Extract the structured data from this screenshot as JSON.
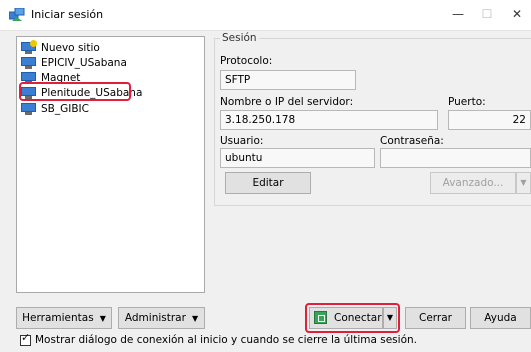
{
  "window": {
    "title": "Iniciar sesión",
    "controls": {
      "minimize": "—",
      "maximize": "☐",
      "close": "✕"
    }
  },
  "sites": [
    {
      "label": "Nuevo sitio",
      "icon": "new-site-icon"
    },
    {
      "label": "EPICIV_USabana",
      "icon": "computer-icon"
    },
    {
      "label": "Magnet",
      "icon": "computer-icon"
    },
    {
      "label": "Plenitude_USabana",
      "icon": "computer-icon",
      "selected": true,
      "highlighted": true
    },
    {
      "label": "SB_GIBIC",
      "icon": "computer-icon"
    }
  ],
  "session": {
    "legend": "Sesión",
    "protocol_label": "Protocolo:",
    "protocol_value": "SFTP",
    "host_label": "Nombre o IP del servidor:",
    "host_value": "3.18.250.178",
    "port_label": "Puerto:",
    "port_value": "22",
    "user_label": "Usuario:",
    "user_value": "ubuntu",
    "password_label": "Contraseña:",
    "password_value": "",
    "edit_button": "Editar",
    "advanced_button": "Avanzado..."
  },
  "footer": {
    "tools_button": "Herramientas",
    "admin_button": "Administrar",
    "connect_button": "Conectar",
    "close_button": "Cerrar",
    "help_button": "Ayuda",
    "show_dialog_label": "Mostrar diálogo de conexión al inicio y cuando se cierre la última sesión.",
    "show_dialog_checked": true
  },
  "colors": {
    "highlight": "#e0203b",
    "accent": "#3a7fd1",
    "connect_icon": "#3aa35a"
  }
}
